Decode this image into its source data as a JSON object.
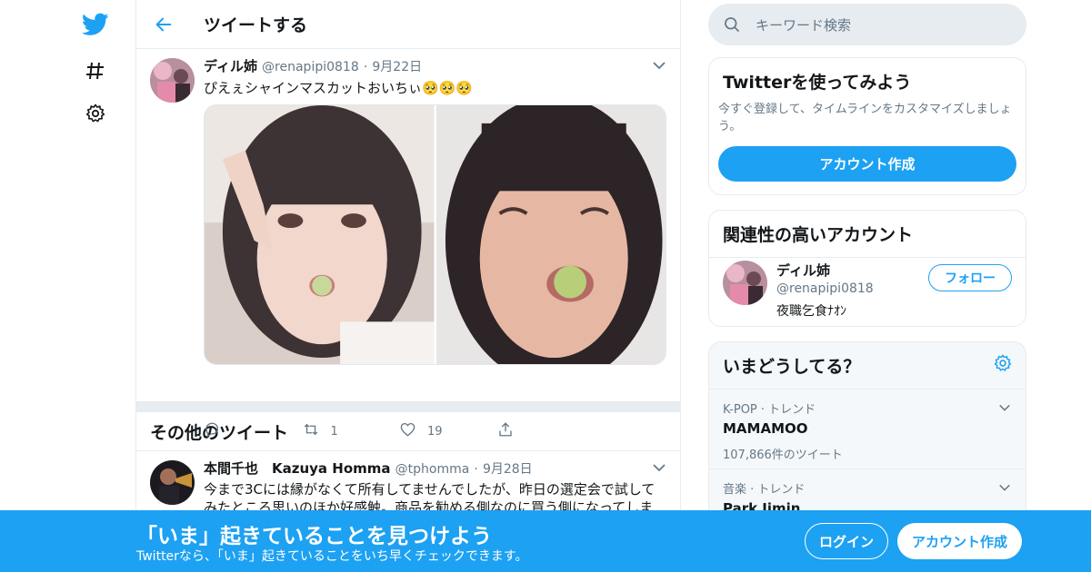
{
  "header": {
    "title": "ツイートする"
  },
  "tweet": {
    "name": "ディル姉",
    "handle": "@renapipi0818",
    "dot": "·",
    "date": "9月22日",
    "text": "ぴえぇシャインマスカットおいちぃ🥺🥺🥺",
    "retweets": "1",
    "likes": "19"
  },
  "more": {
    "title": "その他のツイート"
  },
  "tweet2": {
    "name": "本間千也　Kazuya Homma",
    "handle": "@tphomma",
    "dot": "·",
    "date": "9月28日",
    "text": "今まで3Cには縁がなくて所有してませんでしたが、昨日の選定会で試してみたところ思いのほか好感触。商品を勧める側なのに買う側になってしま"
  },
  "search": {
    "placeholder": "キーワード検索"
  },
  "signup_card": {
    "title": "Twitterを使ってみよう",
    "desc": "今すぐ登録して、タイムラインをカスタマイズしましょう。",
    "button": "アカウント作成"
  },
  "related": {
    "title": "関連性の高いアカウント",
    "name": "ディル姉",
    "handle": "@renapipi0818",
    "bio": "夜職乞食ﾅｵﾝ",
    "follow": "フォロー"
  },
  "trends": {
    "title": "いまどうしてる？",
    "items": [
      {
        "context": "K-POP · トレンド",
        "name": "MAMAMOO",
        "count": "107,866件のツイート"
      },
      {
        "context": "音楽 · トレンド",
        "name": "Park Jimin"
      }
    ]
  },
  "bottom": {
    "headline": "「いま」起きていることを見つけよう",
    "sub": "Twitterなら、「いま」起きていることをいち早くチェックできます。",
    "login": "ログイン",
    "signup": "アカウント作成"
  },
  "colors": {
    "accent": "#1da1f2",
    "border": "#e6ecf0",
    "muted": "#657786"
  }
}
